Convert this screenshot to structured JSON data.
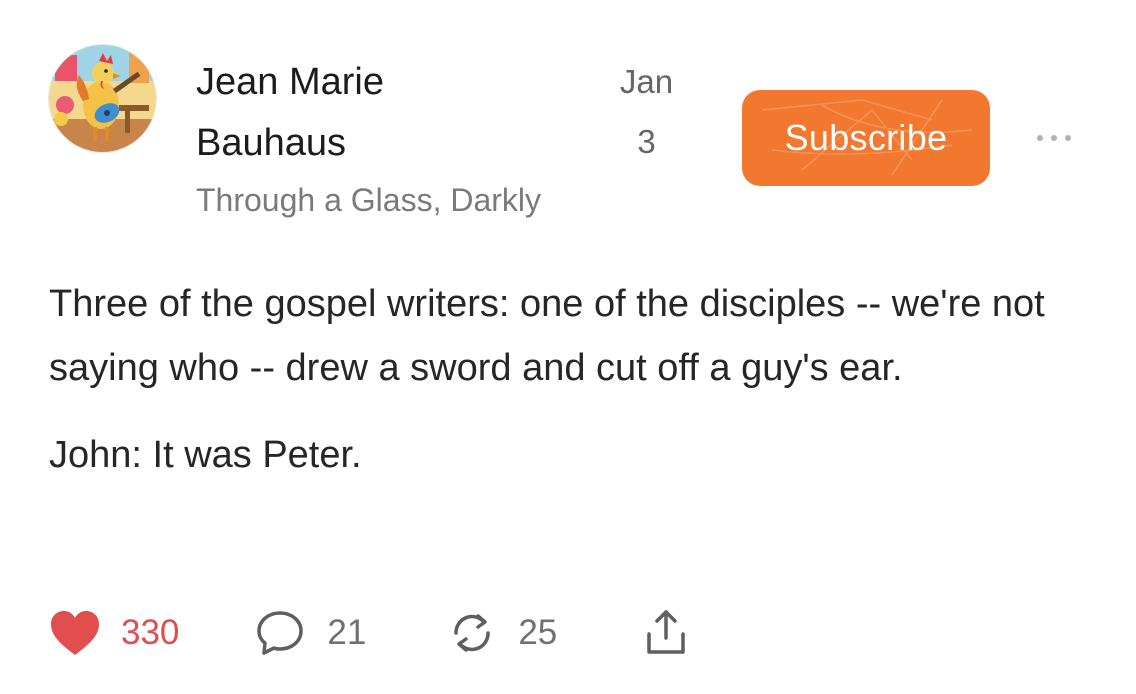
{
  "post": {
    "author": "Jean Marie Bauhaus",
    "date_month": "Jan",
    "date_day": "3",
    "publication": "Through a Glass, Darkly",
    "subscribe_label": "Subscribe",
    "paragraphs": [
      "Three of the gospel writers: one of the disciples -- we're not saying who -- drew a sword and cut off a guy's ear.",
      "John: It was Peter."
    ],
    "stats": {
      "likes": "330",
      "comments": "21",
      "restacks": "25"
    }
  },
  "icons": {
    "avatar": "rooster-guitar-avatar",
    "more": "more-options-icon",
    "like": "heart-icon",
    "comment": "comment-bubble-icon",
    "restack": "restack-icon",
    "share": "share-icon"
  },
  "colors": {
    "accent": "#f2772f",
    "like": "#e24d4d",
    "muted": "#7a7a7a"
  }
}
